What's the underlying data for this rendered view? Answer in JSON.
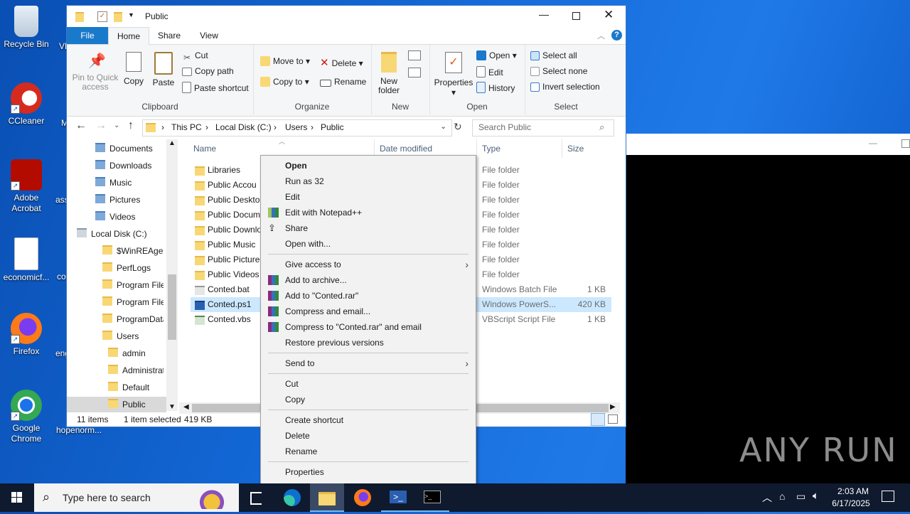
{
  "desktop": {
    "icons": [
      {
        "label": "Recycle Bin"
      },
      {
        "label": "CCleaner"
      },
      {
        "label": "Adobe\nAcrobat"
      },
      {
        "label": "economicf..."
      },
      {
        "label": "Firefox"
      },
      {
        "label": "Google\nChrome"
      }
    ],
    "partial_labels": [
      "VL",
      "M",
      "ass",
      "co",
      "eng",
      "hopenorm..."
    ],
    "watermark": "ANY RUN"
  },
  "explorer": {
    "title": "Public",
    "tabs": [
      "File",
      "Home",
      "Share",
      "View"
    ],
    "ribbon": {
      "clipboard": {
        "pin": "Pin to Quick access",
        "copy": "Copy",
        "paste": "Paste",
        "cut": "Cut",
        "copy_path": "Copy path",
        "paste_shortcut": "Paste shortcut",
        "label": "Clipboard"
      },
      "organize": {
        "move_to": "Move to",
        "copy_to": "Copy to",
        "delete": "Delete",
        "rename": "Rename",
        "label": "Organize"
      },
      "new": {
        "new_folder": "New folder",
        "label": "New"
      },
      "open": {
        "properties": "Properties",
        "open": "Open",
        "edit": "Edit",
        "history": "History",
        "label": "Open"
      },
      "select": {
        "select_all": "Select all",
        "select_none": "Select none",
        "invert": "Invert selection",
        "label": "Select"
      }
    },
    "breadcrumb": [
      "This PC",
      "Local Disk (C:)",
      "Users",
      "Public"
    ],
    "search_placeholder": "Search Public",
    "nav": [
      {
        "label": "Documents",
        "indent": 1
      },
      {
        "label": "Downloads",
        "indent": 1
      },
      {
        "label": "Music",
        "indent": 1
      },
      {
        "label": "Pictures",
        "indent": 1
      },
      {
        "label": "Videos",
        "indent": 1
      },
      {
        "label": "Local Disk (C:)",
        "indent": 0
      },
      {
        "label": "$WinREAgent",
        "indent": 2
      },
      {
        "label": "PerfLogs",
        "indent": 2
      },
      {
        "label": "Program Files",
        "indent": 2
      },
      {
        "label": "Program Files",
        "indent": 2
      },
      {
        "label": "ProgramData",
        "indent": 2
      },
      {
        "label": "Users",
        "indent": 2
      },
      {
        "label": "admin",
        "indent": 3
      },
      {
        "label": "Administrat",
        "indent": 3
      },
      {
        "label": "Default",
        "indent": 3
      },
      {
        "label": "Public",
        "indent": 3
      }
    ],
    "columns": {
      "name": "Name",
      "date": "Date modified",
      "type": "Type",
      "size": "Size"
    },
    "files": [
      {
        "name": "Libraries",
        "type": "File folder",
        "size": ""
      },
      {
        "name": "Public Accou",
        "type": "File folder",
        "size": ""
      },
      {
        "name": "Public Deskto",
        "type": "File folder",
        "size": ""
      },
      {
        "name": "Public Docum",
        "type": "File folder",
        "size": ""
      },
      {
        "name": "Public Downlo",
        "type": "File folder",
        "size": ""
      },
      {
        "name": "Public Music",
        "type": "File folder",
        "size": ""
      },
      {
        "name": "Public Picture",
        "type": "File folder",
        "size": ""
      },
      {
        "name": "Public Videos",
        "type": "File folder",
        "size": ""
      },
      {
        "name": "Conted.bat",
        "type": "Windows Batch File",
        "size": "1 KB"
      },
      {
        "name": "Conted.ps1",
        "type": "Windows PowerS...",
        "size": "420 KB"
      },
      {
        "name": "Conted.vbs",
        "type": "VBScript Script File",
        "size": "1 KB"
      }
    ],
    "status": {
      "items": "11 items",
      "selected": "1 item selected",
      "size": "419 KB"
    }
  },
  "context_menu": [
    {
      "label": "Open",
      "bold": true
    },
    {
      "label": "Run as 32"
    },
    {
      "label": "Edit"
    },
    {
      "label": "Edit with Notepad++"
    },
    {
      "label": "Share"
    },
    {
      "label": "Open with..."
    },
    {
      "label": "Give access to"
    },
    {
      "label": "Add to archive..."
    },
    {
      "label": "Add to \"Conted.rar\""
    },
    {
      "label": "Compress and email..."
    },
    {
      "label": "Compress to \"Conted.rar\" and email"
    },
    {
      "label": "Restore previous versions"
    },
    {
      "label": "Send to"
    },
    {
      "label": "Cut"
    },
    {
      "label": "Copy"
    },
    {
      "label": "Create shortcut"
    },
    {
      "label": "Delete"
    },
    {
      "label": "Rename"
    },
    {
      "label": "Properties"
    }
  ],
  "taskbar": {
    "search_placeholder": "Type here to search",
    "time": "2:03 AM",
    "date": "6/17/2025"
  },
  "colors": {
    "accent": "#0078d7",
    "selection": "#cce8ff",
    "taskbar": "#0f1a2e"
  }
}
